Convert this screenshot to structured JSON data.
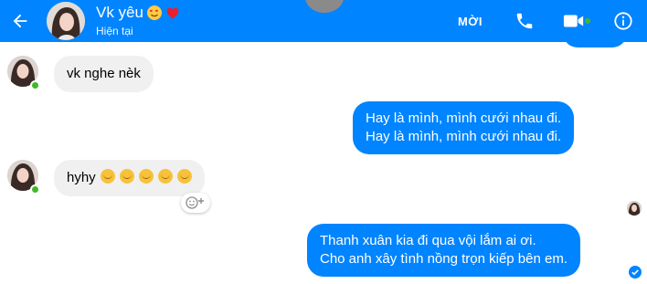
{
  "header": {
    "contact_name": "Vk yêu",
    "status": "Hiện tại",
    "call_label": "MỜI",
    "icons": [
      "back-arrow-icon",
      "phone-icon",
      "video-camera-icon",
      "info-icon"
    ],
    "name_emojis": [
      "heart-eyes-emoji-icon",
      "red-heart-emoji-icon"
    ],
    "accent_color": "#0084ff",
    "online_color": "#42b72a"
  },
  "messages": [
    {
      "direction": "incoming",
      "lines": [
        "vk nghe nèk"
      ]
    },
    {
      "direction": "outgoing",
      "lines": [
        "Hay là mình, mình cưới nhau đi.",
        "Hay là mình, mình cưới nhau đi."
      ]
    },
    {
      "direction": "incoming",
      "text": "hyhy",
      "emoji_count": 5,
      "emoji": "smiling-blush-emoji-icon"
    },
    {
      "direction": "outgoing",
      "lines": [
        "Thanh xuân kia đi qua vội lắm ai ơi.",
        "Cho anh xây tình nồng trọn kiếp bên em."
      ]
    }
  ],
  "colors": {
    "incoming_bubble": "#f1f0f0",
    "outgoing_bubble": "#0084ff"
  }
}
